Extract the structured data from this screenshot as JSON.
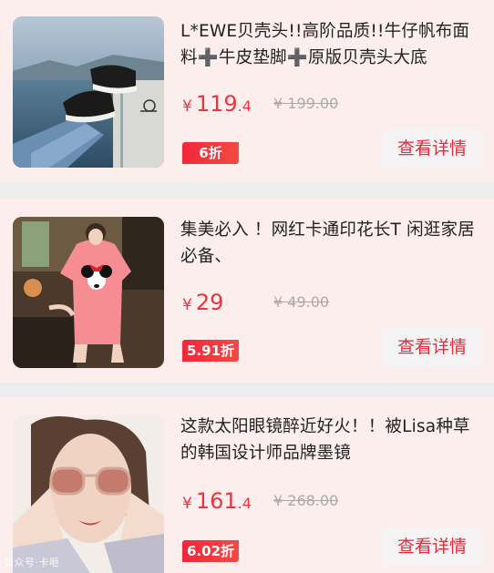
{
  "products": [
    {
      "title": "L*EWE贝壳头!!高阶品质!!牛仔帆布面料➕牛皮垫脚➕原版贝壳头大底",
      "currency": "¥",
      "price_int": "119",
      "price_dec": ".4",
      "original_price": "¥ 199.00",
      "discount": "6折",
      "button": "查看详情",
      "image": "sneakers-photo"
    },
    {
      "title": "集美必入 ！网红卡通印花长T 闲逛家居必备、",
      "currency": "¥",
      "price_int": "29",
      "price_dec": "",
      "original_price": "¥ 49.00",
      "discount": "5.91折",
      "button": "查看详情",
      "image": "pink-tshirt-photo"
    },
    {
      "title": "这款太阳眼镜醉近好火！！被Lisa种草的韩国设计师品牌墨镜",
      "currency": "¥",
      "price_int": "161",
      "price_dec": ".4",
      "original_price": "¥ 268.00",
      "discount": "6.02折",
      "button": "查看详情",
      "image": "sunglasses-photo"
    }
  ],
  "watermark": "公众号·卡咂"
}
